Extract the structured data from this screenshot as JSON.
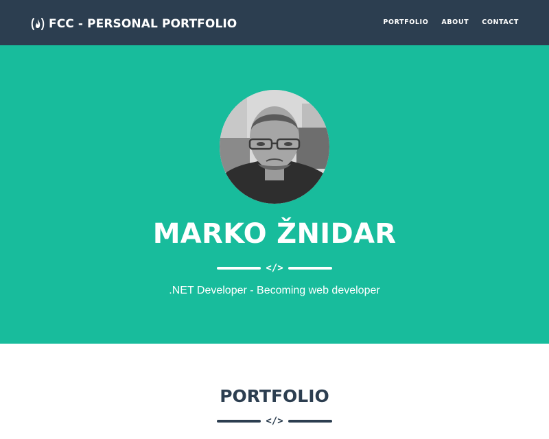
{
  "navbar": {
    "brand_icon": "freecodecamp-flame-icon",
    "brand": "FCC - PERSONAL PORTFOLIO",
    "links": [
      {
        "label": "PORTFOLIO"
      },
      {
        "label": "ABOUT"
      },
      {
        "label": "CONTACT"
      }
    ]
  },
  "hero": {
    "avatar_icon": "profile-photo",
    "name": "MARKO ŽNIDAR",
    "divider_glyph": "</>",
    "subtitle": ".NET Developer - Becoming web developer"
  },
  "portfolio": {
    "title": "PORTFOLIO",
    "divider_glyph": "</>"
  },
  "colors": {
    "navbar": "#2c3e50",
    "hero": "#18bc9c",
    "text_light": "#ffffff",
    "text_dark": "#2c3e50"
  }
}
